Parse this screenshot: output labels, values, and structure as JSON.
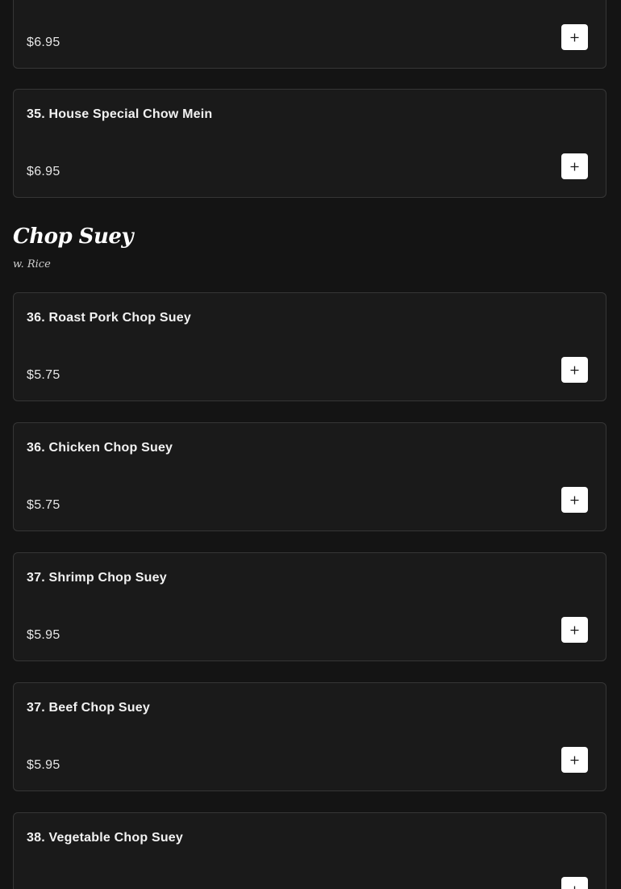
{
  "prev_item": {
    "price": "$6.95"
  },
  "house_special": {
    "name": "35. House Special Chow Mein",
    "price": "$6.95"
  },
  "section": {
    "title": "Chop Suey",
    "subtitle": "w. Rice"
  },
  "items": [
    {
      "name": "36. Roast Pork Chop Suey",
      "price": "$5.75"
    },
    {
      "name": "36. Chicken Chop Suey",
      "price": "$5.75"
    },
    {
      "name": "37. Shrimp Chop Suey",
      "price": "$5.95"
    },
    {
      "name": "37. Beef Chop Suey",
      "price": "$5.95"
    },
    {
      "name": "38. Vegetable Chop Suey",
      "price": ""
    }
  ],
  "icons": {
    "add": "plus-icon"
  },
  "colors": {
    "background": "#141414",
    "card": "#1a1a1a",
    "card_border": "#363636",
    "button": "#ffffff"
  }
}
